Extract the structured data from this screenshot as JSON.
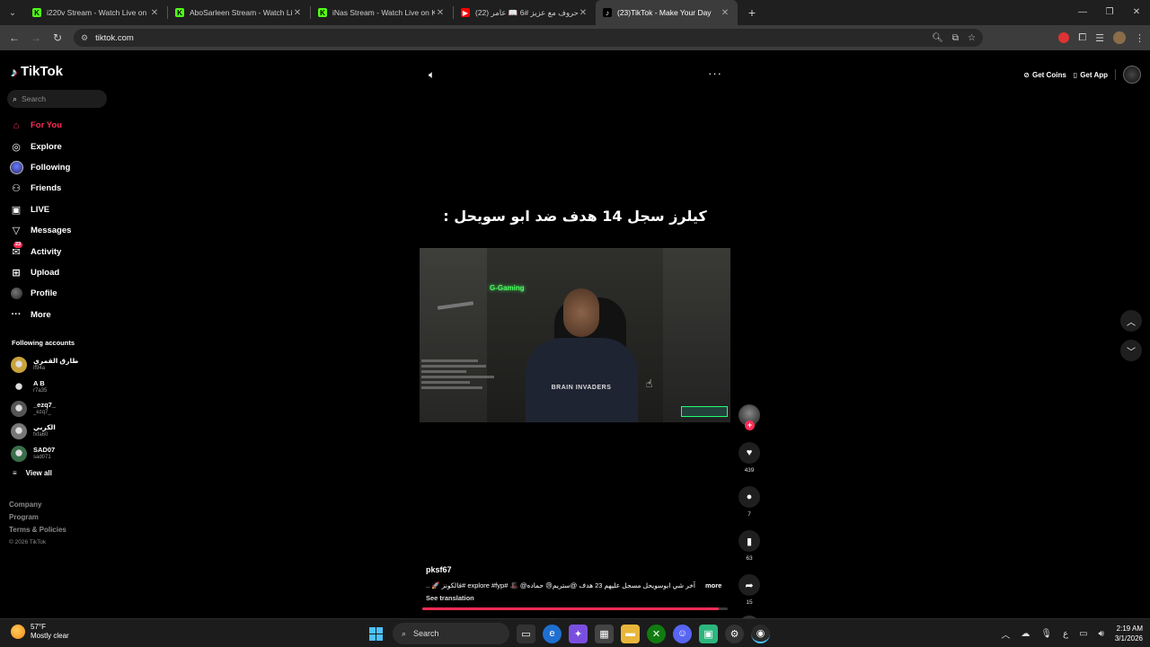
{
  "browser": {
    "tabs": [
      {
        "title": "i220v Stream - Watch Live on Ki",
        "icon": "kick-icon",
        "color": "#53fc18",
        "active": false
      },
      {
        "title": "AboSarleen Stream - Watch Live",
        "icon": "kick-icon",
        "color": "#53fc18",
        "active": false
      },
      {
        "title": "iNas Stream - Watch Live on Ki",
        "icon": "kick-icon",
        "color": "#53fc18",
        "active": false
      },
      {
        "title": "(22) حروف مع عزيز #6 📖 عامر",
        "icon": "youtube-icon",
        "color": "#ff0000",
        "active": false
      },
      {
        "title": "(23)TikTok - Make Your Day",
        "icon": "tiktok-icon",
        "color": "#ffffff",
        "active": true
      }
    ],
    "address": "tiktok.com"
  },
  "tiktok": {
    "logo": "TikTok",
    "search_placeholder": "Search",
    "nav": [
      {
        "label": "For You",
        "icon": "home-icon",
        "active": true
      },
      {
        "label": "Explore",
        "icon": "compass-icon",
        "active": false
      },
      {
        "label": "Following",
        "icon": "following-icon",
        "active": false
      },
      {
        "label": "Friends",
        "icon": "friends-icon",
        "active": false
      },
      {
        "label": "LIVE",
        "icon": "live-icon",
        "active": false
      },
      {
        "label": "Messages",
        "icon": "messages-icon",
        "active": false
      },
      {
        "label": "Activity",
        "icon": "activity-icon",
        "active": false,
        "badge": "23"
      },
      {
        "label": "Upload",
        "icon": "upload-icon",
        "active": false
      },
      {
        "label": "Profile",
        "icon": "profile-icon",
        "active": false
      },
      {
        "label": "More",
        "icon": "more-icon",
        "active": false
      }
    ],
    "following_title": "Following accounts",
    "following": [
      {
        "name": "طارق القمري",
        "handle": "lf94a",
        "color": "#c9a23a"
      },
      {
        "name": "A B",
        "handle": "r7a35",
        "color": "#000000"
      },
      {
        "name": "_ezq7_",
        "handle": "_ezq7_",
        "color": "#555555"
      },
      {
        "name": "الكربي",
        "handle": "fxfa60",
        "color": "#777777"
      },
      {
        "name": "SAD07",
        "handle": "sad071",
        "color": "#3a6e4a"
      }
    ],
    "view_all": "View all",
    "footer": [
      "Company",
      "Program",
      "Terms & Policies"
    ],
    "copyright": "© 2026 TikTok",
    "top_right": {
      "coins": "Get Coins",
      "app": "Get App"
    },
    "headline": "كيلرز سجل 14 هدف ضد ابو سويحل :",
    "video": {
      "neon_text": "G-Gaming",
      "shirt_text": "BRAIN INVADERS"
    },
    "actions": {
      "likes": "439",
      "comments": "7",
      "saves": "63",
      "shares": "15"
    },
    "caption": {
      "user": "pksf67",
      "text": "آخر شي ابوسويحل مسجل عليهم 23 هدف @ستريم😢 حماده@ 🎩 #explore #fyp #فالكونز 🚀 ...",
      "more": "more",
      "see_translation": "See translation"
    },
    "progress": 0.97
  },
  "taskbar": {
    "temp": "57°F",
    "weather": "Mostly clear",
    "search": "Search",
    "time": "2:19 AM",
    "date": "3/1/2026"
  }
}
